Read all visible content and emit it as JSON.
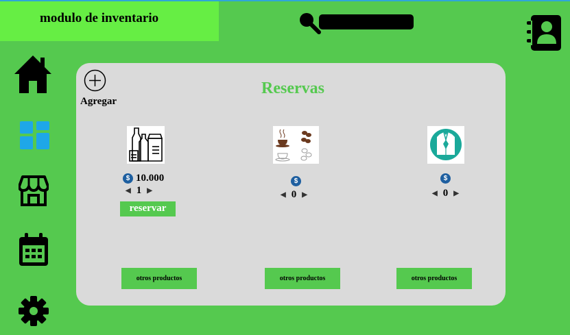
{
  "header": {
    "title": "modulo de inventario",
    "search_icon": "search-icon",
    "contact_icon": "address-book-icon"
  },
  "sidebar": {
    "items": [
      {
        "icon": "home-icon"
      },
      {
        "icon": "dashboard-icon",
        "color": "#1ea7e8"
      },
      {
        "icon": "store-icon"
      },
      {
        "icon": "calendar-icon"
      },
      {
        "icon": "gear-icon"
      }
    ]
  },
  "panel": {
    "title": "Reservas",
    "add_label": "Agregar",
    "products": [
      {
        "image": "grocery-bottles-icon",
        "price": "10.000",
        "quantity": "1",
        "reserve_label": "reservar",
        "other_label": "otros productos"
      },
      {
        "image": "coffee-icon",
        "price": "",
        "quantity": "0",
        "other_label": "otros productos"
      },
      {
        "image": "shirt-icon",
        "price": "",
        "quantity": "0",
        "other_label": "otros productos"
      }
    ]
  },
  "colors": {
    "background": "#55c94f",
    "title_box": "#66ee44",
    "panel": "#dadada",
    "accent_blue": "#1ea7e8",
    "coin": "#1e5fa0"
  }
}
